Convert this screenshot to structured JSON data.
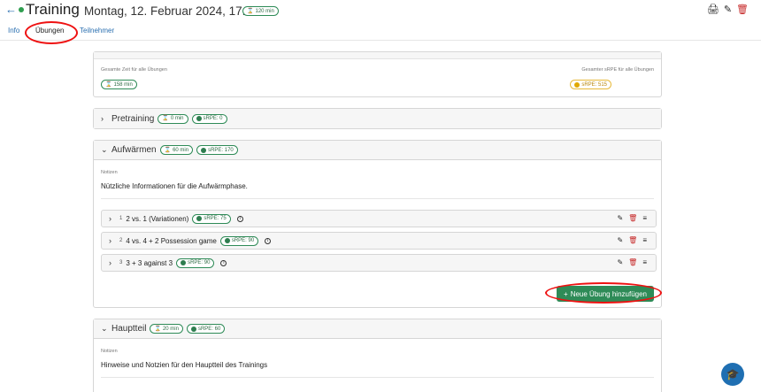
{
  "header": {
    "back_icon": "arrow-left-icon",
    "title": "Training",
    "datetime": "Montag, 12. Februar 2024, 17:00",
    "duration_badge": "120 min",
    "actions": [
      "print-icon",
      "edit-icon",
      "trash-icon"
    ]
  },
  "tabs": [
    {
      "label": "Info"
    },
    {
      "label": "Übungen",
      "active": true
    },
    {
      "label": "Teilnehmer"
    }
  ],
  "summary": {
    "total_time_label": "Gesamte Zeit für alle Übungen",
    "total_time_value": "158 min",
    "total_srpe_label": "Gesamter sRPE für alle Übungen",
    "total_srpe_value": "sRPE: 515"
  },
  "sections": [
    {
      "name": "Pretraining",
      "time": "0 min",
      "srpe": "sRPE: 0",
      "expanded": false
    },
    {
      "name": "Aufwärmen",
      "time": "60 min",
      "srpe": "sRPE: 170",
      "expanded": true,
      "notes_label": "Notizen",
      "notes": "Nützliche Informationen für die Aufwärmphase.",
      "exercises": [
        {
          "num": "1",
          "name": "2 vs. 1 (Variationen)",
          "srpe": "sRPE: 75"
        },
        {
          "num": "2",
          "name": "4 vs. 4 + 2 Possession game",
          "srpe": "sRPE: 90"
        },
        {
          "num": "3",
          "name": "3 + 3 against 3",
          "srpe": "sRPE: 90"
        }
      ],
      "add_button": "Neue Übung hinzufügen"
    },
    {
      "name": "Hauptteil",
      "time": "20 min",
      "srpe": "sRPE: 60",
      "expanded": true,
      "notes_label": "Notizen",
      "notes": "Hinweise und Notzien für den Hauptteil des Trainings"
    }
  ],
  "colors": {
    "accent_green": "#2e8b57",
    "link_blue": "#2a6fb0",
    "danger_red": "#c62828",
    "highlight_red": "#ee1111",
    "srpe_yellow": "#e7b93b",
    "fab_blue": "#1f6fb2"
  },
  "fab_icon": "graduation-cap-icon"
}
